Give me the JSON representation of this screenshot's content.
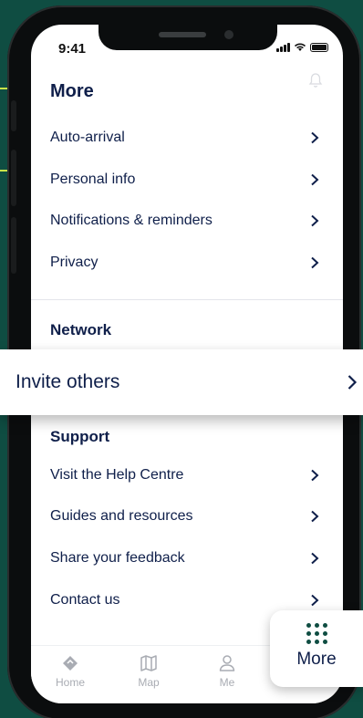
{
  "status": {
    "time": "9:41"
  },
  "sections": {
    "more": {
      "title": "More",
      "items": [
        {
          "label": "Auto-arrival"
        },
        {
          "label": "Personal info"
        },
        {
          "label": "Notifications & reminders"
        },
        {
          "label": "Privacy"
        }
      ]
    },
    "network": {
      "title": "Network",
      "items": [
        {
          "label": "Invite others"
        }
      ]
    },
    "support": {
      "title": "Support",
      "items": [
        {
          "label": "Visit the Help Centre"
        },
        {
          "label": "Guides and resources"
        },
        {
          "label": "Share your feedback"
        },
        {
          "label": "Contact us"
        }
      ]
    }
  },
  "tabbar": {
    "tabs": [
      {
        "label": "Home",
        "icon": "home-diamond-icon"
      },
      {
        "label": "Map",
        "icon": "map-icon"
      },
      {
        "label": "Me",
        "icon": "person-icon"
      },
      {
        "label": "More",
        "icon": "grid-dots-icon"
      }
    ]
  },
  "colors": {
    "background": "#0f4d42",
    "accent": "#c9e34a",
    "text_primary": "#0f1f4a",
    "tab_inactive": "#a9acb3"
  }
}
